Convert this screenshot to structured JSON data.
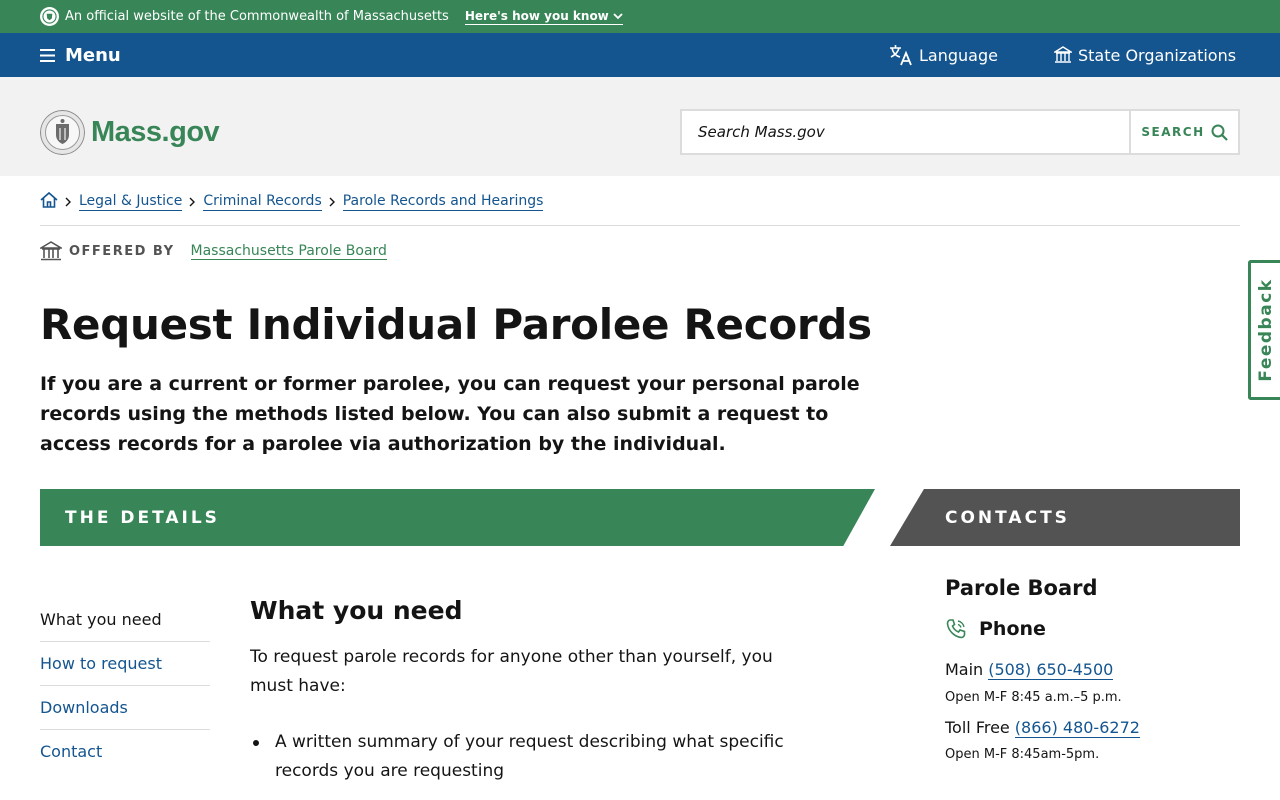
{
  "official_banner": {
    "text": "An official website of the Commonwealth of Massachusetts",
    "how_you_know": "Here's how you know"
  },
  "nav": {
    "menu_label": "Menu",
    "language_label": "Language",
    "state_orgs_label": "State Organizations"
  },
  "header": {
    "logo_text": "Mass.gov",
    "search_placeholder": "Search Mass.gov",
    "search_button": "SEARCH"
  },
  "breadcrumb": {
    "items": [
      "Legal & Justice",
      "Criminal Records",
      "Parole Records and Hearings"
    ]
  },
  "offered_by": {
    "label": "OFFERED BY",
    "org": "Massachusetts Parole Board"
  },
  "page": {
    "title": "Request Individual Parolee Records",
    "lede": "If you are a current or former parolee, you can request your personal parole records using the methods listed below. You can also submit a request to access records for a parolee via authorization by the individual."
  },
  "feedback_label": "Feedback",
  "details_banner": "THE DETAILS",
  "contacts_banner": "CONTACTS",
  "jump_nav": {
    "items": [
      "What you need",
      "How to request",
      "Downloads",
      "Contact"
    ]
  },
  "content": {
    "heading": "What you need",
    "intro": "To request parole records for anyone other than yourself, you must have:",
    "list": [
      "A written summary of your request describing what specific records you are requesting"
    ]
  },
  "contacts": {
    "name": "Parole Board",
    "phone_heading": "Phone",
    "main_label": "Main",
    "main_number": "(508) 650-4500",
    "main_hours": "Open M-F 8:45 a.m.–5 p.m.",
    "tollfree_label": "Toll Free",
    "tollfree_number": "(866) 480-6272",
    "tollfree_hours": "Open M-F 8:45am-5pm."
  },
  "colors": {
    "green": "#388557",
    "blue": "#14558f",
    "gray_banner": "#535353",
    "header_bg": "#f2f2f2"
  },
  "icons": [
    "state-seal-icon",
    "chevron-down-icon",
    "hamburger-icon",
    "translate-icon",
    "building-icon",
    "search-icon",
    "home-icon",
    "chevron-right-icon",
    "phone-icon"
  ]
}
